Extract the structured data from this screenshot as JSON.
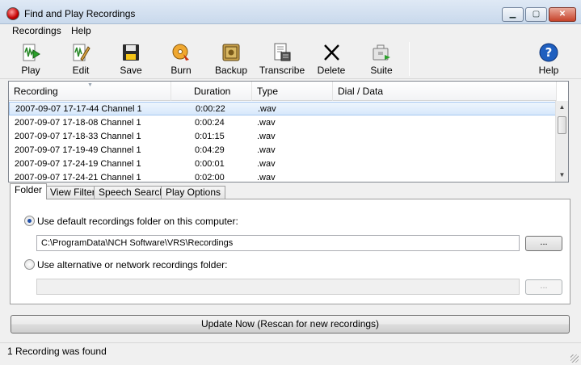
{
  "window": {
    "title": "Find and Play Recordings",
    "controls": {
      "minimize": "▁",
      "maximize": "▢",
      "close": "✕"
    }
  },
  "menu": {
    "items": [
      "Recordings",
      "Help"
    ]
  },
  "toolbar": {
    "buttons": [
      {
        "label": "Play",
        "icon": "play-waveform-icon"
      },
      {
        "label": "Edit",
        "icon": "edit-waveform-icon"
      },
      {
        "label": "Save",
        "icon": "floppy-disk-icon"
      },
      {
        "label": "Burn",
        "icon": "burn-disc-icon"
      },
      {
        "label": "Backup",
        "icon": "safe-icon"
      },
      {
        "label": "Transcribe",
        "icon": "transcribe-icon"
      },
      {
        "label": "Delete",
        "icon": "delete-x-icon"
      },
      {
        "label": "Suite",
        "icon": "suitcase-icon"
      },
      {
        "label": "Help",
        "icon": "help-icon"
      }
    ]
  },
  "list": {
    "columns": [
      "Recording",
      "Duration",
      "Type",
      "Dial / Data"
    ],
    "rows": [
      {
        "recording": "2007-09-07 17-17-44 Channel 1",
        "duration": "0:00:22",
        "type": ".wav",
        "dial": ""
      },
      {
        "recording": "2007-09-07 17-18-08 Channel 1",
        "duration": "0:00:24",
        "type": ".wav",
        "dial": ""
      },
      {
        "recording": "2007-09-07 17-18-33 Channel 1",
        "duration": "0:01:15",
        "type": ".wav",
        "dial": ""
      },
      {
        "recording": "2007-09-07 17-19-49 Channel 1",
        "duration": "0:04:29",
        "type": ".wav",
        "dial": ""
      },
      {
        "recording": "2007-09-07 17-24-19 Channel 1",
        "duration": "0:00:01",
        "type": ".wav",
        "dial": ""
      },
      {
        "recording": "2007-09-07 17-24-21 Channel 1",
        "duration": "0:02:00",
        "type": ".wav",
        "dial": ""
      }
    ]
  },
  "tabs": [
    "Folder",
    "View Filter",
    "Speech Search",
    "Play Options"
  ],
  "folder": {
    "default_label": "Use default recordings folder on this computer:",
    "default_path": "C:\\ProgramData\\NCH Software\\VRS\\Recordings",
    "browse_label": "...",
    "alt_label": "Use alternative or network recordings folder:",
    "alt_path": "",
    "alt_browse_label": "..."
  },
  "update_button": "Update Now (Rescan for new recordings)",
  "status": "1 Recording was found"
}
